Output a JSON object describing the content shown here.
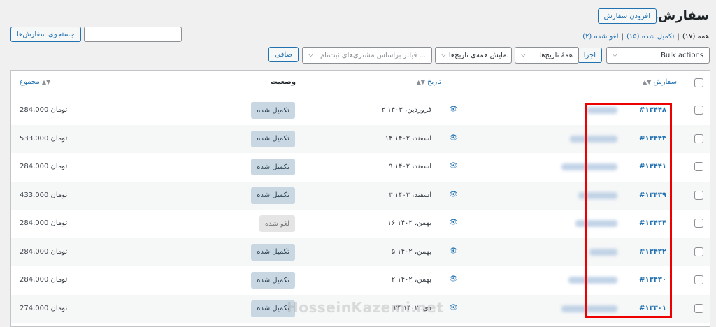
{
  "header": {
    "title": "سفارش‌ها",
    "add_order": "افزودن سفارش",
    "views": [
      {
        "label": "همه",
        "count": "(۱۷)"
      },
      {
        "label": "تکمیل شده",
        "count": "(۱۵)"
      },
      {
        "label": "لغو شده",
        "count": "(۲)"
      }
    ]
  },
  "search": {
    "button": "جستجوی سفارش‌ها",
    "value": ""
  },
  "filters": {
    "bulk_actions": "Bulk actions",
    "apply": "اجرا",
    "all_dates": "همهٔ تاریخ‌ها",
    "show_all_dates": "نمایش همه‌ی تاریخ‌ها",
    "customer_placeholder": "فیلتر براساس مشتری‌های ثبت‌نام ...",
    "filter_button": "صافی"
  },
  "columns": {
    "order": "سفارش",
    "date": "تاریخ",
    "status": "وضعیت",
    "total": "مجموع"
  },
  "orders": [
    {
      "number": "#۱۳۴۴۸",
      "date": "۲ فروردین، ۱۴۰۳",
      "status": "تکمیل شده",
      "status_type": "done",
      "total": "284,000  تومان"
    },
    {
      "number": "#۱۳۴۴۳",
      "date": "۱۴ اسفند، ۱۴۰۲",
      "status": "تکمیل شده",
      "status_type": "done",
      "total": "533,000  تومان"
    },
    {
      "number": "#۱۳۴۴۱",
      "date": "۹ اسفند، ۱۴۰۲",
      "status": "تکمیل شده",
      "status_type": "done",
      "total": "284,000  تومان"
    },
    {
      "number": "#۱۳۴۳۹",
      "date": "۳ اسفند، ۱۴۰۲",
      "status": "تکمیل شده",
      "status_type": "done",
      "total": "433,000  تومان"
    },
    {
      "number": "#۱۳۴۳۴",
      "date": "۱۶ بهمن، ۱۴۰۲",
      "status": "لغو شده",
      "status_type": "cancel",
      "total": "284,000  تومان"
    },
    {
      "number": "#۱۳۴۳۲",
      "date": "۵ بهمن، ۱۴۰۲",
      "status": "تکمیل شده",
      "status_type": "done",
      "total": "284,000  تومان"
    },
    {
      "number": "#۱۳۴۳۰",
      "date": "۲ بهمن، ۱۴۰۲",
      "status": "تکمیل شده",
      "status_type": "done",
      "total": "284,000  تومان"
    },
    {
      "number": "#۱۳۳۰۱",
      "date": "۲۴ دی، ۱۴۰۲",
      "status": "تکمیل شده",
      "status_type": "done",
      "total": "274,000  تومان"
    }
  ],
  "watermark": "HosseinKazemi.net",
  "colors": {
    "accent": "#2271b1",
    "highlight": "#ee0000"
  }
}
